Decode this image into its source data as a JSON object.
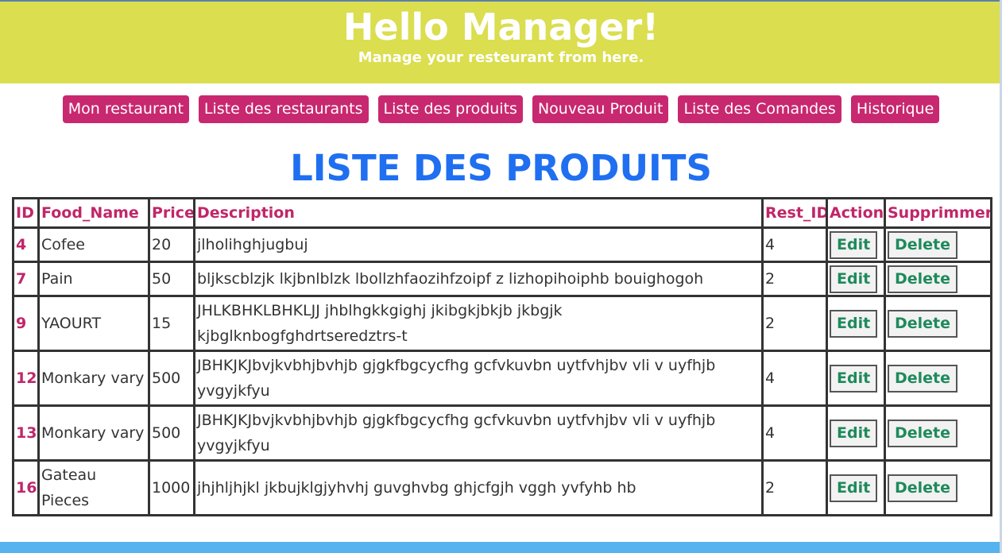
{
  "header": {
    "title": "Hello Manager!",
    "subtitle": "Manage your resteurant from here."
  },
  "nav": {
    "items": [
      {
        "label": "Mon restaurant"
      },
      {
        "label": "Liste des restaurants"
      },
      {
        "label": "Liste des produits"
      },
      {
        "label": "Nouveau Produit"
      },
      {
        "label": "Liste des Comandes"
      },
      {
        "label": "Historique"
      }
    ]
  },
  "page_title": "LISTE DES PRODUITS",
  "table": {
    "columns": [
      "ID",
      "Food_Name",
      "Price",
      "Description",
      "Rest_ID",
      "Action",
      "Supprimmer"
    ],
    "edit_label": "Edit",
    "delete_label": "Delete",
    "rows": [
      {
        "id": "4",
        "name": "Cofee",
        "price": "20",
        "description": "jlholihghjugbuj",
        "rest_id": "4"
      },
      {
        "id": "7",
        "name": "Pain",
        "price": "50",
        "description": "bljkscblzjk lkjbnlblzk lbollzhfaozihfzoipf z lizhopihoiphb bouighogoh",
        "rest_id": "2"
      },
      {
        "id": "9",
        "name": "YAOURT",
        "price": "15",
        "description": "JHLKBHKLBHKLJJ jhblhgkkgighj jkibgkjbkjb jkbgjk kjbglknbogfghdrtseredztrs-t",
        "rest_id": "2"
      },
      {
        "id": "12",
        "name": "Monkary vary",
        "price": "500",
        "description": "JBHKJKJbvjkvbhjbvhjb gjgkfbgcycfhg gcfvkuvbn uytfvhjbv vli v uyfhjb yvgyjkfyu",
        "rest_id": "4"
      },
      {
        "id": "13",
        "name": "Monkary vary",
        "price": "500",
        "description": "JBHKJKJbvjkvbhjbvhjb gjgkfbgcycfhg gcfvkuvbn uytfvhjbv vli v uyfhjb yvgyjkfyu",
        "rest_id": "4"
      },
      {
        "id": "16",
        "name": "Gateau Pieces",
        "price": "1000",
        "description": "jhjhljhjkl jkbujklgjyhvhj guvghvbg ghjcfgjh vggh yvfyhb hb",
        "rest_id": "2"
      }
    ]
  },
  "colors": {
    "header_bg": "#dade4f",
    "nav_bg": "#c8286f",
    "title": "#1f6ff0",
    "table_header_text": "#c0266a",
    "button_text": "#1f8a5c",
    "footer_bar": "#55b3f0"
  }
}
